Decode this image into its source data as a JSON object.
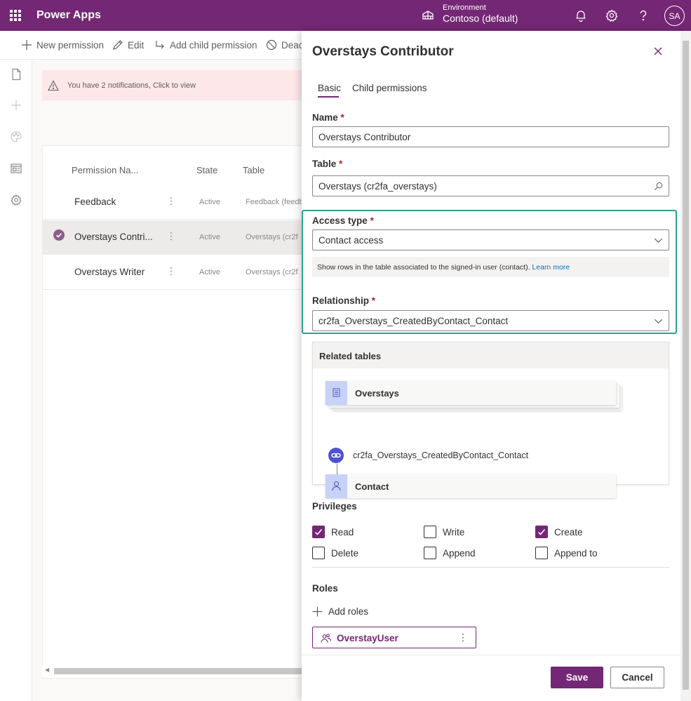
{
  "topbar": {
    "app_title": "Power Apps",
    "env_label": "Environment",
    "env_value": "Contoso (default)",
    "avatar": "SA",
    "icons": [
      "waffle-icon",
      "environment-icon",
      "bell-icon",
      "gear-icon",
      "help-icon"
    ]
  },
  "commandbar": {
    "new_permission": "New permission",
    "edit": "Edit",
    "add_child_permission": "Add child permission",
    "deactivate": "Deac"
  },
  "notification": {
    "text": "You have 2 notifications, Click to view"
  },
  "grid": {
    "columns": [
      "Permission Na...",
      "State",
      "Table"
    ],
    "rows": [
      {
        "name": "Feedback",
        "state": "Active",
        "table": "Feedback (feedb",
        "selected": false
      },
      {
        "name": "Overstays Contri...",
        "state": "Active",
        "table": "Overstays (cr2f",
        "selected": true
      },
      {
        "name": "Overstays Writer",
        "state": "Active",
        "table": "Overstays (cr2f",
        "selected": false
      }
    ]
  },
  "panel": {
    "title": "Overstays Contributor",
    "tabs": [
      "Basic",
      "Child permissions"
    ],
    "active_tab": "Basic",
    "name_label": "Name",
    "name_value": "Overstays Contributor",
    "table_label": "Table",
    "table_value": "Overstays (cr2fa_overstays)",
    "access_type_label": "Access type",
    "access_type_value": "Contact access",
    "access_info": "Show rows in the table associated to the signed-in user (contact).",
    "learn_more": "Learn more",
    "relationship_label": "Relationship",
    "relationship_value": "cr2fa_Overstays_CreatedByContact_Contact",
    "required_mark": "*",
    "related_tables": {
      "header": "Related tables",
      "source": "Overstays",
      "link": "cr2fa_Overstays_CreatedByContact_Contact",
      "target": "Contact"
    },
    "privileges_label": "Privileges",
    "privileges": {
      "read": {
        "label": "Read",
        "checked": true
      },
      "write": {
        "label": "Write",
        "checked": false
      },
      "create": {
        "label": "Create",
        "checked": true
      },
      "delete": {
        "label": "Delete",
        "checked": false
      },
      "append": {
        "label": "Append",
        "checked": false
      },
      "append_to": {
        "label": "Append to",
        "checked": false
      }
    },
    "roles_label": "Roles",
    "add_roles": "Add roles",
    "role": "OverstayUser",
    "save": "Save",
    "cancel": "Cancel"
  },
  "colors": {
    "brand": "#742774",
    "highlight": "#2aa58c",
    "related_icon": "#c7d3f6",
    "link_icon": "#4f52d6"
  }
}
